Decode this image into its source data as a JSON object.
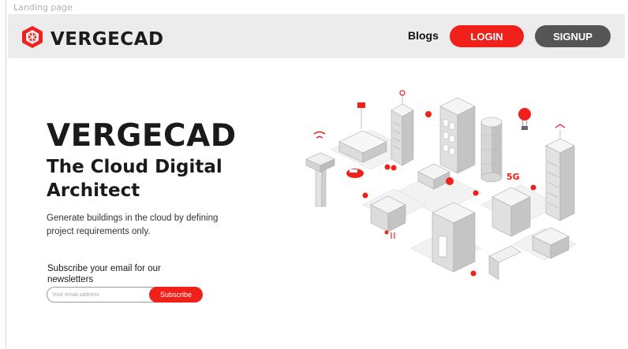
{
  "frame": {
    "label": "Landing page"
  },
  "header": {
    "brand": "VERGECAD",
    "nav_blogs": "Blogs",
    "login_label": "LOGIN",
    "signup_label": "SIGNUP"
  },
  "hero": {
    "brand": "VERGECAD",
    "subtitle": "The Cloud Digital Architect",
    "description": "Generate buildings in the cloud by defining project requirements only."
  },
  "newsletter": {
    "title": "Subscribe your email for our newsletters",
    "email_placeholder": "Your email address",
    "subscribe_label": "Subscribe"
  },
  "colors": {
    "accent": "#f0201b",
    "dark_button": "#555555",
    "navbar_bg": "#ececec"
  },
  "illustration": {
    "badge_text": "5G"
  }
}
